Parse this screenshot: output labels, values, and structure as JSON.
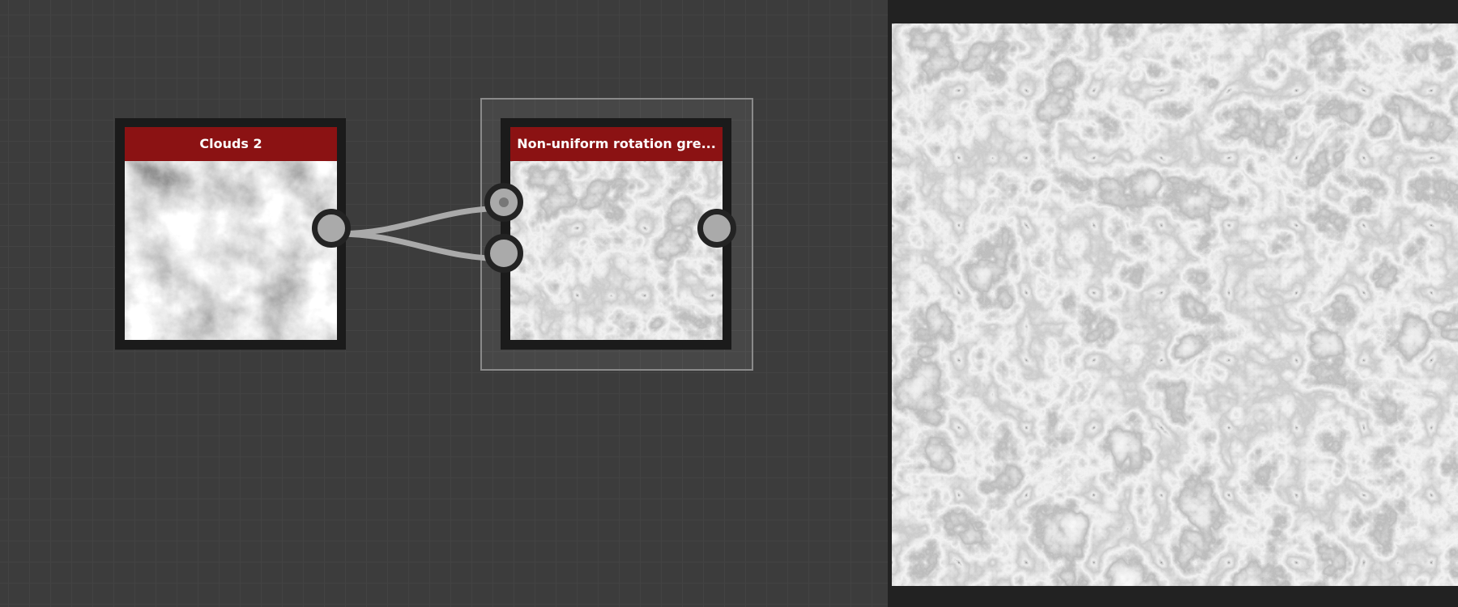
{
  "graph": {
    "nodes": [
      {
        "title": "Clouds 2",
        "thumbnail": "clouds-noise-texture"
      },
      {
        "title": "Non-uniform rotation gre...",
        "thumbnail": "marbled-rotation-texture",
        "selected": true
      }
    ],
    "connections": [
      {
        "from": "Clouds 2.output",
        "to": "Non-uniform rotation gre....input-1"
      },
      {
        "from": "Clouds 2.output",
        "to": "Non-uniform rotation gre....input-2"
      }
    ]
  },
  "preview": {
    "content": "marbled-rotation-texture"
  },
  "colors": {
    "node_header": "#8b1213",
    "canvas_bg": "#3c3c3c",
    "wire": "#aaaaaa"
  }
}
